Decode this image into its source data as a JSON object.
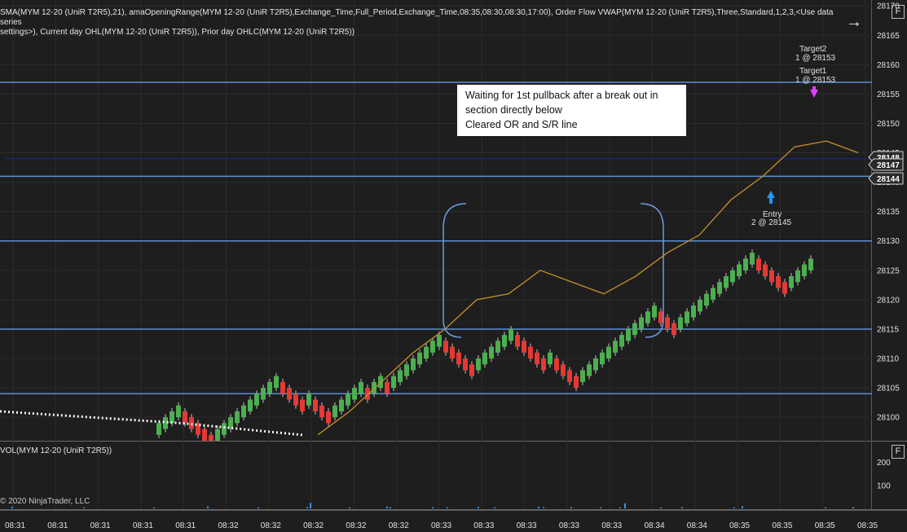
{
  "header": {
    "indicators_line1": "SMA(MYM 12-20 (UniR T2R5),21), amaOpeningRange(MYM 12-20 (UniR T2R5),Exchange_Time,Full_Period,Exchange_Time,08:35,08:30,08:30,17:00), Order Flow VWAP(MYM 12-20 (UniR T2R5),Three,Standard,1,2,3,<Use data series",
    "indicators_line2": "settings>), Current day OHL(MYM 12-20 (UniR T2R5)), Prior day OHLC(MYM 12-20 (UniR T2R5))"
  },
  "icons": {
    "arrow": "right-arrow-icon",
    "f_box": "F"
  },
  "annotation": {
    "line1": "Waiting for 1st pullback after a break out in",
    "line2": "section directly below",
    "line3": "Cleared OR and S/R line"
  },
  "volume_panel": {
    "label": "VOL(MYM 12-20 (UniR T2R5))"
  },
  "copyright": "© 2020 NinjaTrader, LLC",
  "colors": {
    "up": "#4caf50",
    "down": "#e53935",
    "sr_line": "#5b8fd6",
    "current_line": "#1a237e",
    "sma": "#c8902c",
    "bracket": "#6d9be0",
    "volume": "#3d8fe0",
    "target_arrow": "#e040fb",
    "entry_arrow": "#2196f3"
  },
  "chart_data": {
    "type": "candlestick",
    "instrument": "MYM 12-20 (UniR T2R5)",
    "ylim": [
      28096,
      28171
    ],
    "y_ticks": [
      28100,
      28105,
      28110,
      28115,
      28120,
      28125,
      28130,
      28135,
      28140,
      28145,
      28150,
      28155,
      28160,
      28165,
      28170
    ],
    "x_tick_labels": [
      "08:31",
      "08:31",
      "08:31",
      "08:31",
      "08:31",
      "08:32",
      "08:32",
      "08:32",
      "08:32",
      "08:32",
      "08:33",
      "08:33",
      "08:33",
      "08:33",
      "08:33",
      "08:34",
      "08:34",
      "08:35",
      "08:35",
      "08:35",
      "08:35"
    ],
    "current_price_tags": [
      28148,
      28147,
      28144
    ],
    "horizontal_lines": [
      28157,
      28144,
      28141,
      28130,
      28115,
      28104
    ],
    "candles_dir": "UUUUDDDDDUUUUUUUUUUDDDDUDDDUUUUUDUUDUUUUUUUUDDDDDUUUUUUDDDDDUDDDDUUUUUUUUUUUUDDDUUUUUUUUUUUUDDDDDUUUU",
    "candle_start_price": 28097,
    "candle_start_index": 10,
    "sma": [
      [
        50,
        28097
      ],
      [
        55,
        28101
      ],
      [
        60,
        28106
      ],
      [
        65,
        28111
      ],
      [
        70,
        28115
      ],
      [
        75,
        28120
      ],
      [
        80,
        28121
      ],
      [
        85,
        28125
      ],
      [
        90,
        28123
      ],
      [
        95,
        28121
      ],
      [
        100,
        28124
      ],
      [
        105,
        28128
      ],
      [
        110,
        28131
      ],
      [
        115,
        28137
      ],
      [
        120,
        28141
      ],
      [
        125,
        28146
      ],
      [
        130,
        28147
      ],
      [
        135,
        28145
      ]
    ],
    "vwap_dots": [
      [
        0,
        28101
      ],
      [
        30,
        28099
      ],
      [
        50,
        28097
      ]
    ],
    "annotations": [
      {
        "label": "Target2",
        "sub": "1 @ 28153"
      },
      {
        "label": "Target1",
        "sub": "1 @ 28153"
      },
      {
        "label": "Entry",
        "sub": "2 @ 28145"
      }
    ],
    "volume": {
      "y_ticks": [
        100,
        200
      ],
      "ylim": [
        0,
        280
      ],
      "bars": [
        [
          14,
          8
        ],
        [
          102,
          5
        ],
        [
          188,
          5
        ],
        [
          254,
          9
        ],
        [
          316,
          5
        ],
        [
          376,
          6
        ],
        [
          380,
          24
        ],
        [
          428,
          5
        ],
        [
          474,
          8
        ],
        [
          478,
          5
        ],
        [
          530,
          5
        ],
        [
          548,
          5
        ],
        [
          586,
          7
        ],
        [
          606,
          5
        ],
        [
          660,
          8
        ],
        [
          666,
          5
        ],
        [
          700,
          6
        ],
        [
          736,
          5
        ],
        [
          760,
          5
        ],
        [
          766,
          22
        ],
        [
          810,
          5
        ],
        [
          836,
          6
        ],
        [
          900,
          5
        ],
        [
          910,
          10
        ],
        [
          1012,
          5
        ],
        [
          1046,
          6
        ]
      ]
    }
  }
}
